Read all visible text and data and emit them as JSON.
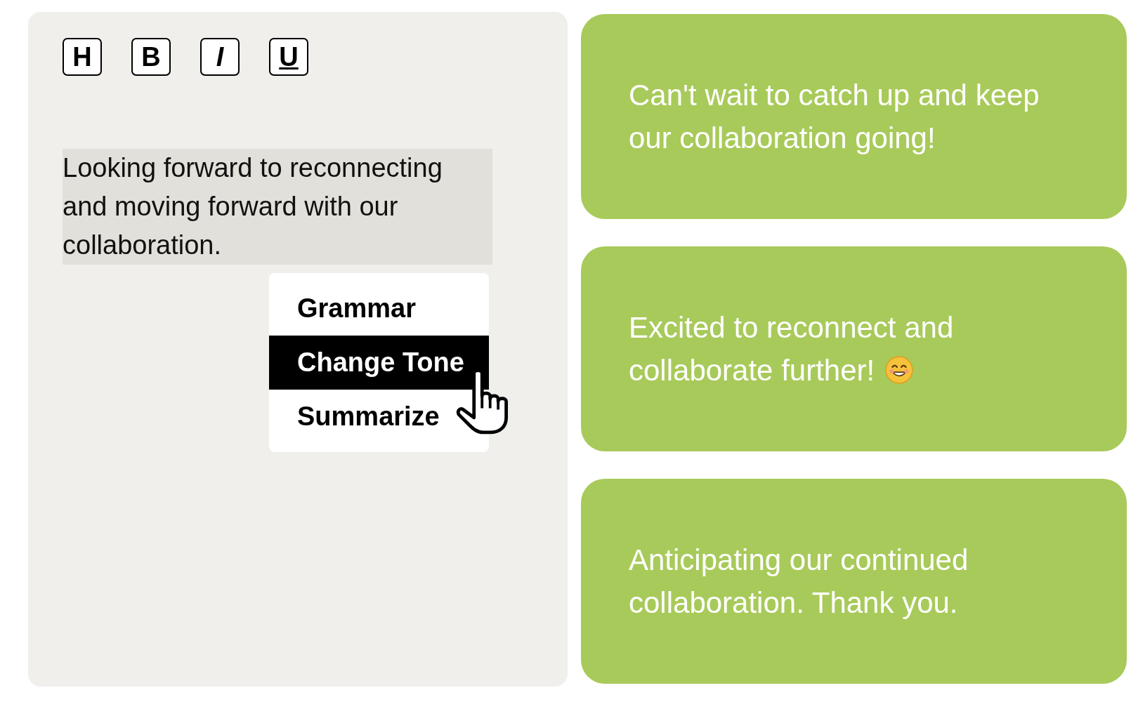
{
  "toolbar": [
    {
      "label": "H",
      "kind": "heading"
    },
    {
      "label": "B",
      "kind": "bold"
    },
    {
      "label": "I",
      "kind": "italic"
    },
    {
      "label": "U",
      "kind": "underline"
    }
  ],
  "editor": {
    "text": "Looking forward to reconnecting and moving forward with our collaboration.",
    "selected": true
  },
  "menu": [
    {
      "label": "Grammar",
      "selected": false
    },
    {
      "label": "Change Tone",
      "selected": true
    },
    {
      "label": "Summarize",
      "selected": false
    }
  ],
  "suggestions": [
    {
      "text": "Can't wait to catch up and keep our collaboration going!",
      "emoji": false
    },
    {
      "text": "Excited to reconnect and collaborate further!",
      "emoji": true
    },
    {
      "text": "Anticipating our continued collaboration. Thank you.",
      "emoji": false
    }
  ]
}
